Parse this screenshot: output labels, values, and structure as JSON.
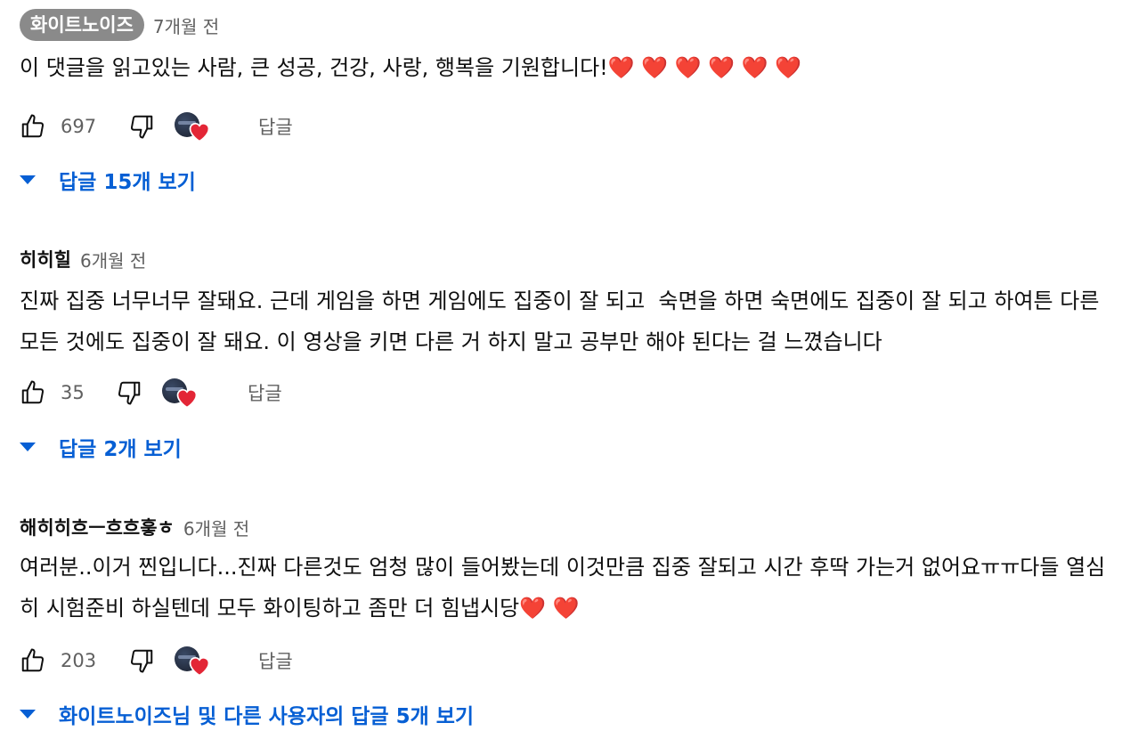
{
  "colors": {
    "link": "#065fd4",
    "heart": "#e32636",
    "muted": "#606060",
    "chip": "#8a8a8a"
  },
  "comments": [
    {
      "author": "화이트노이즈",
      "author_is_creator": true,
      "time": "7개월 전",
      "text": "이 댓글을 읽고있는 사람, 큰 성공, 건강, 사랑, 행복을 기원합니다!",
      "hearts": "❤️ ❤️ ❤️ ❤️ ❤️ ❤️",
      "likes": "697",
      "reply_label": "답글",
      "view_replies": "답글 15개 보기"
    },
    {
      "author": "히히힐",
      "author_is_creator": false,
      "time": "6개월 전",
      "text": "진짜 집중 너무너무 잘돼요. 근데 게임을 하면 게임에도 집중이 잘 되고  숙면을 하면 숙면에도 집중이 잘 되고 하여튼 다른 모든 것에도 집중이 잘 돼요. 이 영상을 키면 다른 거 하지 말고 공부만 해야 된다는 걸 느꼈습니다",
      "hearts": "",
      "likes": "35",
      "reply_label": "답글",
      "view_replies": "답글 2개 보기"
    },
    {
      "author": "해히히흐ㅡ흐흐흫ㅎ",
      "author_is_creator": false,
      "time": "6개월 전",
      "text": "여러분..이거 찐입니다...진짜 다른것도 엄청 많이 들어봤는데 이것만큼 집중 잘되고 시간 후딱 가는거 없어요ㅠㅠ다들 열심히 시험준비 하실텐데 모두 화이팅하고 좀만 더 힘냅시당",
      "hearts": "❤️ ❤️",
      "likes": "203",
      "reply_label": "답글",
      "view_replies": "화이트노이즈님 및 다른 사용자의 답글 5개 보기"
    }
  ],
  "icons": {
    "like": "thumbs-up-icon",
    "dislike": "thumbs-down-icon",
    "creator_heart": "creator-heart-icon",
    "expand": "caret-down-icon"
  }
}
